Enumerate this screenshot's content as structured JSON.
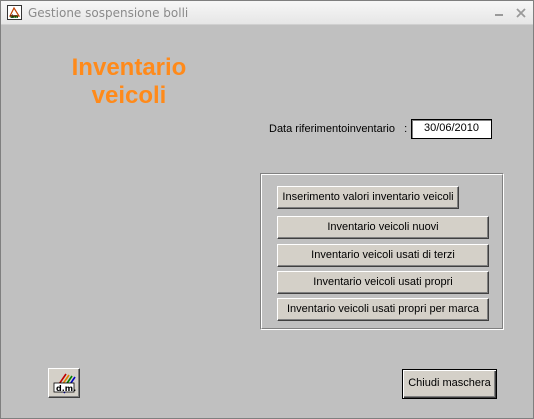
{
  "window": {
    "title": "Gestione sospensione bolli",
    "icon": "app-logo-icon",
    "controls": [
      "minimize-icon",
      "close-icon"
    ]
  },
  "heading": {
    "line1": "Inventario",
    "line2": "veicoli",
    "color": "#ff8a1a"
  },
  "date": {
    "label": "Data riferimentoinventario   :",
    "value": "30/06/2010"
  },
  "buttons": {
    "inserimento": "Inserimento valori inventario veicoli",
    "nuovi": "Inventario veicoli nuovi",
    "usati_terzi": "Inventario veicoli usati di terzi",
    "usati_propri": "Inventario veicoli usati propri",
    "usati_propri_marca": "Inventario veicoli usati propri per marca",
    "chiudi": "Chiudi maschera"
  },
  "logo_button": {
    "icon": "dm-logo-icon"
  }
}
